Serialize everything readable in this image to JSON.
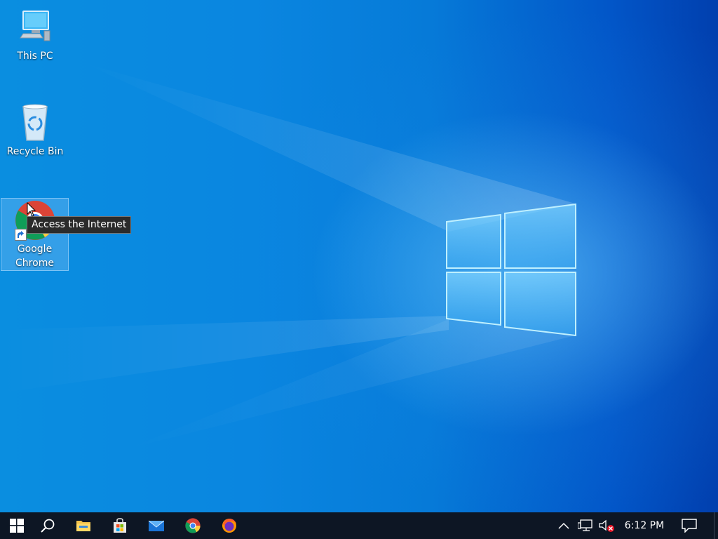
{
  "desktop": {
    "icons": [
      {
        "label": "This PC"
      },
      {
        "label": "Recycle Bin"
      },
      {
        "label_line1": "Google",
        "label_line2": "Chrome"
      }
    ],
    "tooltip": "Access the Internet"
  },
  "taskbar": {
    "apps": [
      "start-icon",
      "search-icon",
      "file-explorer-icon",
      "microsoft-store-icon",
      "mail-icon",
      "chrome-icon",
      "firefox-icon"
    ],
    "clock": "6:12 PM"
  },
  "colors": {
    "taskbar": "#0d1624",
    "desktop_light": "#0a8ee0",
    "desktop_dark": "#013fae"
  }
}
